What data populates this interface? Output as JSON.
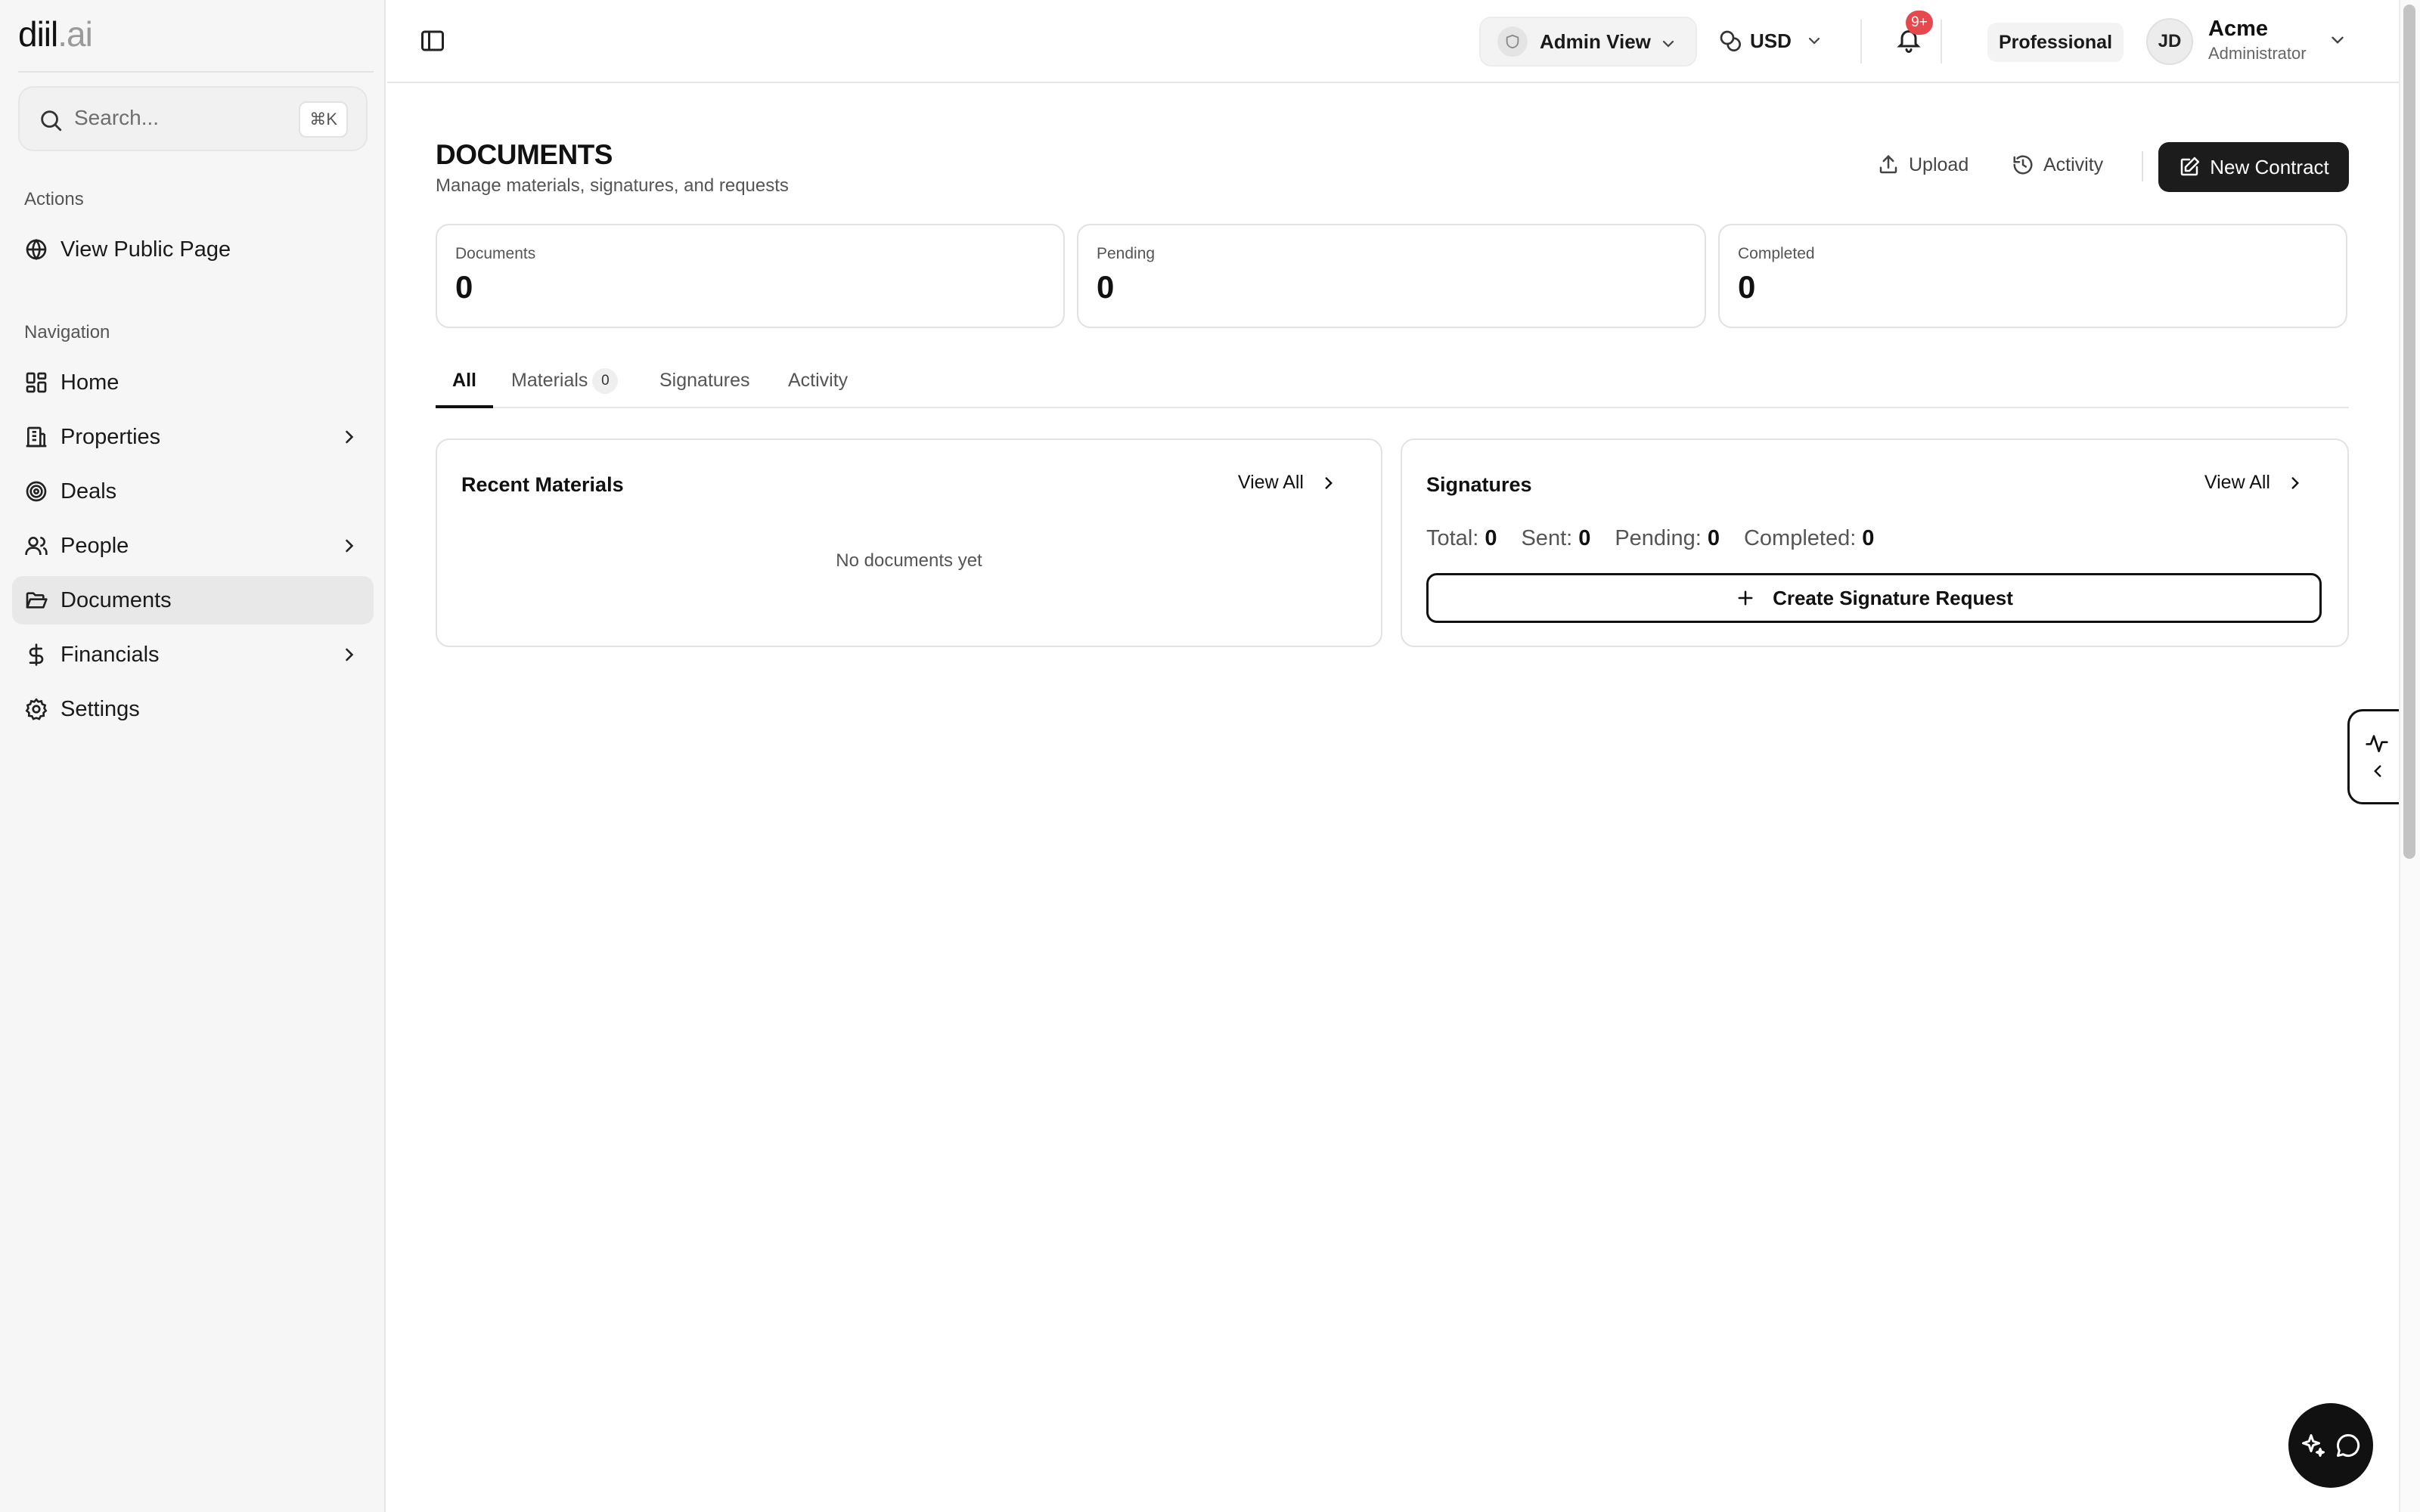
{
  "app": {
    "logo_main": "diil",
    "logo_dot": ".ai"
  },
  "sidebar": {
    "search_placeholder": "Search...",
    "search_shortcut": "⌘K",
    "actions_label": "Actions",
    "view_public_page": "View Public Page",
    "navigation_label": "Navigation",
    "items": [
      {
        "label": "Home",
        "icon": "home-grid-icon",
        "has_children": false,
        "active": false
      },
      {
        "label": "Properties",
        "icon": "building-icon",
        "has_children": true,
        "active": false
      },
      {
        "label": "Deals",
        "icon": "target-icon",
        "has_children": false,
        "active": false
      },
      {
        "label": "People",
        "icon": "users-icon",
        "has_children": true,
        "active": false
      },
      {
        "label": "Documents",
        "icon": "folder-open-icon",
        "has_children": false,
        "active": true
      },
      {
        "label": "Financials",
        "icon": "dollar-icon",
        "has_children": true,
        "active": false
      },
      {
        "label": "Settings",
        "icon": "gear-icon",
        "has_children": false,
        "active": false
      }
    ]
  },
  "header": {
    "view_mode": "Admin View",
    "currency": "USD",
    "notification_badge": "9+",
    "plan": "Professional",
    "avatar_initials": "JD",
    "account_name": "Acme",
    "account_role": "Administrator"
  },
  "page": {
    "title": "DOCUMENTS",
    "subtitle": "Manage materials, signatures, and requests",
    "upload_label": "Upload",
    "activity_label": "Activity",
    "new_contract_label": "New Contract"
  },
  "stats": [
    {
      "label": "Documents",
      "value": "0"
    },
    {
      "label": "Pending",
      "value": "0"
    },
    {
      "label": "Completed",
      "value": "0"
    }
  ],
  "tabs": [
    {
      "label": "All",
      "active": true
    },
    {
      "label": "Materials",
      "count": "0"
    },
    {
      "label": "Signatures"
    },
    {
      "label": "Activity"
    }
  ],
  "recent_materials": {
    "title": "Recent Materials",
    "view_all": "View All",
    "empty": "No documents yet"
  },
  "signatures": {
    "title": "Signatures",
    "view_all": "View All",
    "total_label": "Total:",
    "total_value": "0",
    "sent_label": "Sent:",
    "sent_value": "0",
    "pending_label": "Pending:",
    "pending_value": "0",
    "completed_label": "Completed:",
    "completed_value": "0",
    "create_label": "Create Signature Request"
  },
  "colors": {
    "accent_dark": "#1c1c1c",
    "badge_red": "#e5484d",
    "sidebar_bg": "#f6f6f6",
    "active_item_bg": "#e8e8e8"
  }
}
